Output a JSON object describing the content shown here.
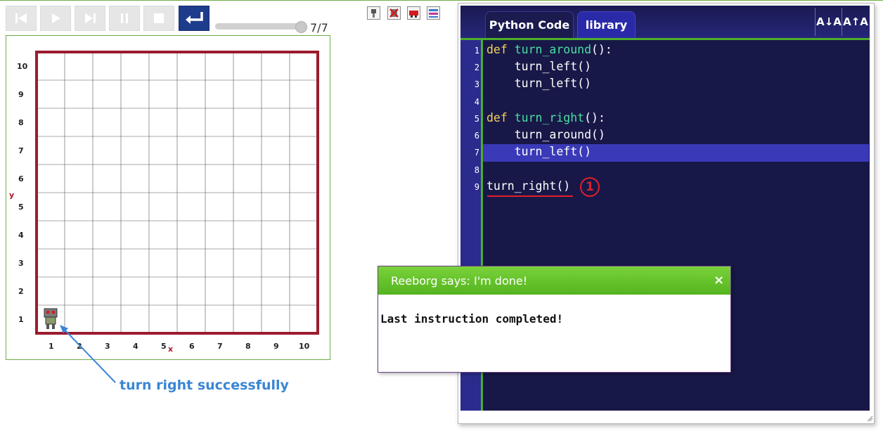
{
  "controls": {
    "buttons": [
      "reload",
      "run",
      "step",
      "pause",
      "stop",
      "return"
    ],
    "step_counter": "7/7",
    "progress": 1.0
  },
  "tools": [
    "robot-icon",
    "delete-robot-icon",
    "edit-world-icon",
    "save-world-icon"
  ],
  "world": {
    "y_label": "y",
    "x_label": "x",
    "x_ticks": [
      "1",
      "2",
      "3",
      "4",
      "5",
      "6",
      "7",
      "8",
      "9",
      "10"
    ],
    "y_ticks": [
      "10",
      "9",
      "8",
      "7",
      "6",
      "5",
      "4",
      "3",
      "2",
      "1"
    ],
    "robot_position": {
      "x": 1,
      "y": 1
    },
    "wall_color": "#9b1b2e"
  },
  "annotation": "turn right successfully",
  "editor": {
    "tabs": [
      "Python Code",
      "library"
    ],
    "font_buttons": [
      "A↓A",
      "A↑A"
    ],
    "line_numbers": [
      "1",
      "2",
      "3",
      "4",
      "5",
      "6",
      "7",
      "8",
      "9"
    ],
    "highlighted_line": 7,
    "error_marker": "1",
    "colors": {
      "background": "#181848",
      "gutter": "#2b2b8e",
      "accent": "#4caf2a",
      "keyword": "#f5d45a",
      "function": "#48e0a0"
    }
  },
  "code": {
    "line1": {
      "kw": "def",
      "fn": "turn_around",
      "rest": "():"
    },
    "line2": "    turn_left()",
    "line3": "    turn_left()",
    "line5": {
      "kw": "def",
      "fn": "turn_right",
      "rest": "():"
    },
    "line6": "    turn_around()",
    "line7": "    turn_left()",
    "line9": "turn_right()"
  },
  "dialog": {
    "title": "Reeborg says: I'm done!",
    "close": "×",
    "message": "Last instruction completed!"
  }
}
